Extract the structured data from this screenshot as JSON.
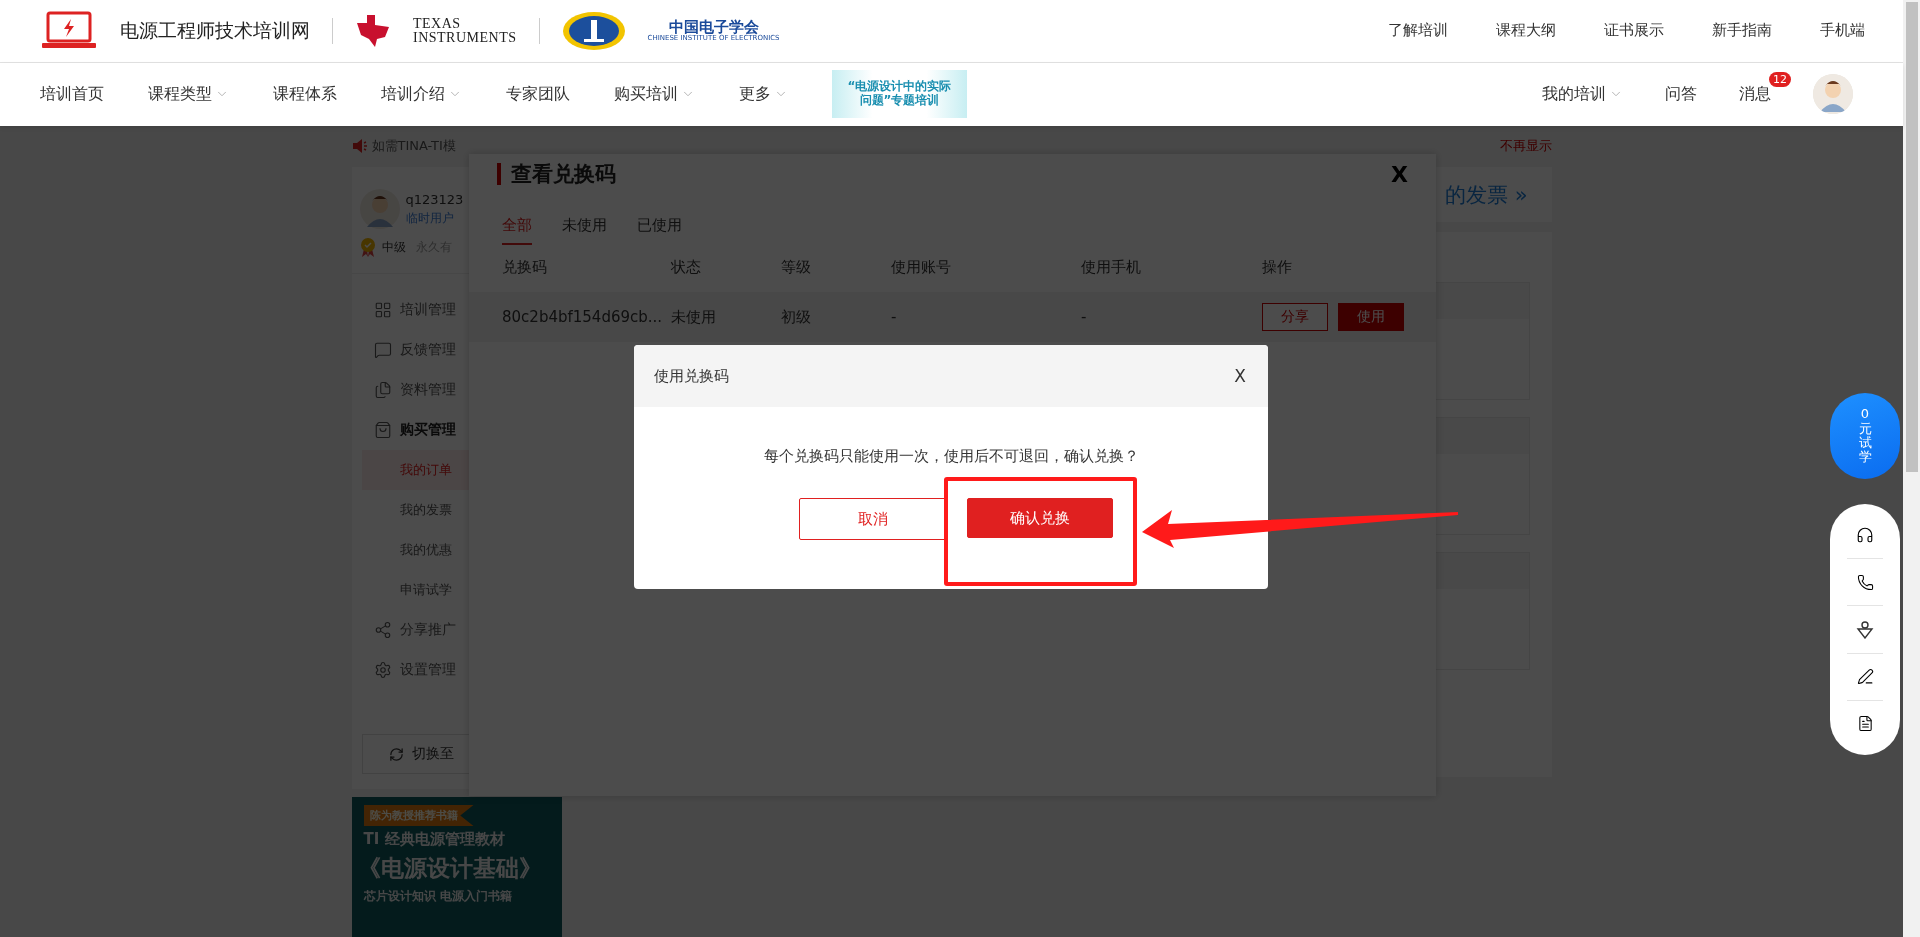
{
  "brand": {
    "site_name": "电源工程师技术培训网",
    "ti_line_1": "TEXAS",
    "ti_line_2": "INSTRUMENTS",
    "cie_name": "中国电子学会",
    "cie_english": "CHINESE INSTITUTE OF ELECTRONICS"
  },
  "top_links": [
    "了解培训",
    "课程大纲",
    "证书展示",
    "新手指南",
    "手机端"
  ],
  "nav": [
    {
      "label": "培训首页",
      "dropdown": false
    },
    {
      "label": "课程类型",
      "dropdown": true
    },
    {
      "label": "课程体系",
      "dropdown": false
    },
    {
      "label": "培训介绍",
      "dropdown": true
    },
    {
      "label": "专家团队",
      "dropdown": false
    },
    {
      "label": "购买培训",
      "dropdown": true
    },
    {
      "label": "更多",
      "dropdown": true
    }
  ],
  "promo_banner": {
    "line_1": "“电源设计中的实际",
    "line_2": "问题”专题培训"
  },
  "user_nav": [
    {
      "label": "我的培训",
      "dropdown": true
    },
    {
      "label": "问答",
      "dropdown": false
    },
    {
      "label": "消息",
      "dropdown": false,
      "badge": "12"
    }
  ],
  "notice": {
    "text": "如需TINA-TI模",
    "dismiss": "不再显示"
  },
  "profile": {
    "username": "q123123",
    "role": "临时用户",
    "level": "中级",
    "validity": "永久有"
  },
  "sidebar": {
    "items": [
      {
        "label": "培训管理",
        "selected": false,
        "expanded": false
      },
      {
        "label": "反馈管理",
        "selected": false,
        "expanded": false
      },
      {
        "label": "资料管理",
        "selected": false,
        "expanded": false
      },
      {
        "label": "购买管理",
        "selected": false,
        "expanded": true,
        "children": [
          {
            "label": "我的订单",
            "selected": true
          },
          {
            "label": "我的发票",
            "selected": false
          },
          {
            "label": "我的优惠",
            "selected": false
          },
          {
            "label": "申请试学",
            "selected": false
          }
        ]
      },
      {
        "label": "分享推广",
        "selected": false,
        "expanded": false
      },
      {
        "label": "设置管理",
        "selected": false,
        "expanded": false
      }
    ],
    "switch_button": "切换至"
  },
  "book_ad": {
    "ribbon": "陈为教授推荐书籍",
    "line_1": "TI 经典电源管理教材",
    "title": "《电源设计基础》",
    "subtitle": "芯片设计知识 电源入门书籍"
  },
  "invoice_link": "的发票 »",
  "code_modal": {
    "title": "查看兑换码",
    "close": "X",
    "tabs": [
      {
        "label": "全部",
        "selected": true
      },
      {
        "label": "未使用",
        "selected": false
      },
      {
        "label": "已使用",
        "selected": false
      }
    ],
    "columns": [
      "兑换码",
      "状态",
      "等级",
      "使用账号",
      "使用手机",
      "操作"
    ],
    "rows": [
      {
        "code": "80c2b4bf154d69cb...",
        "status": "未使用",
        "level": "初级",
        "account": "-",
        "phone": "-",
        "actions": [
          {
            "label": "分享",
            "kind": "outline"
          },
          {
            "label": "使用",
            "kind": "filled"
          }
        ]
      }
    ]
  },
  "confirm_dialog": {
    "title": "使用兑换码",
    "close": "X",
    "message": "每个兑换码只能使用一次，使用后不可退回，确认兑换？",
    "buttons": [
      {
        "label": "取消",
        "kind": "secondary"
      },
      {
        "label": "确认兑换",
        "kind": "primary"
      }
    ]
  },
  "float_bar": {
    "trial": "0元试学"
  }
}
